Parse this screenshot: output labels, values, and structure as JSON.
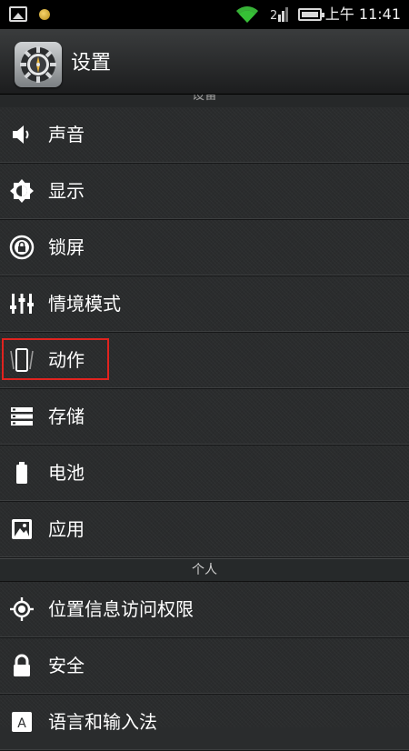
{
  "status_bar": {
    "time": "上午 11:41",
    "icons": [
      "gallery-icon",
      "notification-dot-icon",
      "wifi-icon",
      "sim-icon",
      "battery-icon"
    ]
  },
  "action_bar": {
    "title": "设置",
    "icon": "settings-gear-icon"
  },
  "peek_header": "设备",
  "sections": {
    "device_items": [
      {
        "label": "声音",
        "icon": "speaker-icon"
      },
      {
        "label": "显示",
        "icon": "brightness-icon"
      },
      {
        "label": "锁屏",
        "icon": "lock-screen-icon"
      },
      {
        "label": "情境模式",
        "icon": "sliders-icon"
      },
      {
        "label": "动作",
        "icon": "motion-phone-icon",
        "highlighted": true
      },
      {
        "label": "存储",
        "icon": "storage-icon"
      },
      {
        "label": "电池",
        "icon": "battery-icon"
      },
      {
        "label": "应用",
        "icon": "apps-icon"
      }
    ],
    "personal_header": "个人",
    "personal_items": [
      {
        "label": "位置信息访问权限",
        "icon": "location-icon"
      },
      {
        "label": "安全",
        "icon": "padlock-icon"
      },
      {
        "label": "语言和输入法",
        "icon": "language-icon"
      }
    ]
  },
  "colors": {
    "highlight_border": "#e0231f",
    "background": "#2a2c2d",
    "status_bar": "#000000"
  }
}
